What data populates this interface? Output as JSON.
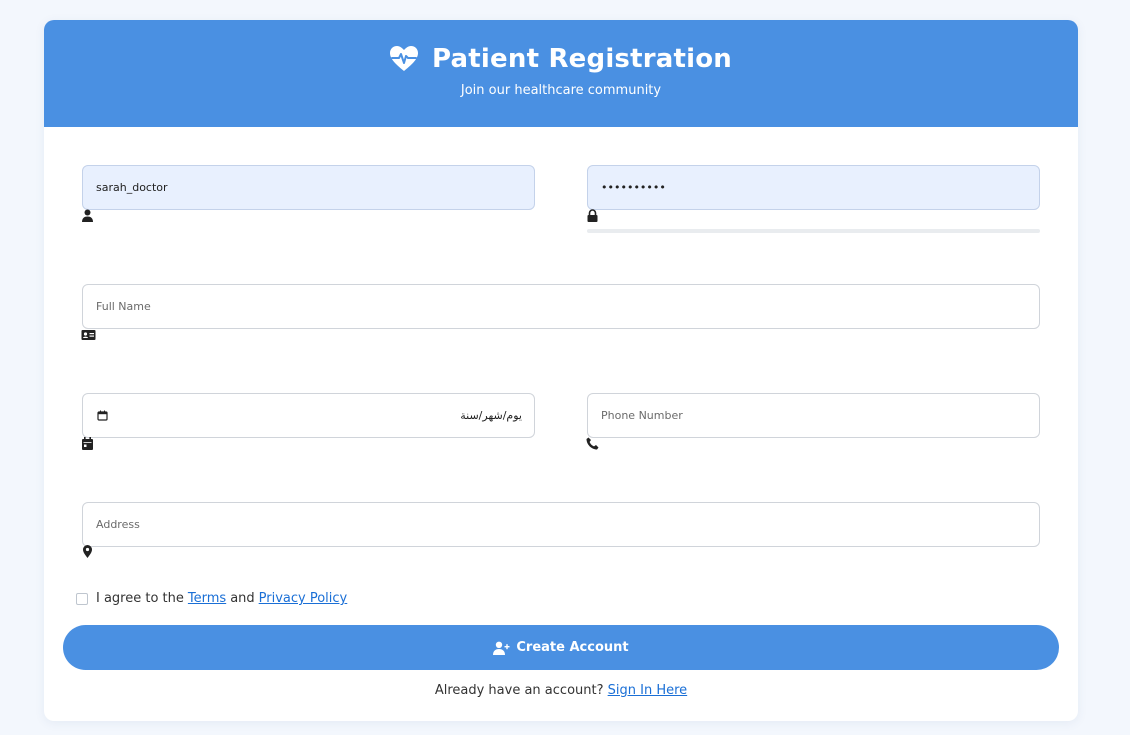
{
  "header": {
    "title": "Patient Registration",
    "subtitle": "Join our healthcare community",
    "icon": "heart-pulse-icon",
    "accent_color": "#4a90e2"
  },
  "form": {
    "username": {
      "value": "sarah_doctor",
      "icon": "user-icon"
    },
    "password": {
      "value": "••••••••••",
      "icon": "lock-icon",
      "strength": 0
    },
    "full_name": {
      "value": "",
      "placeholder": "Full Name",
      "icon": "id-card-icon"
    },
    "date_of_birth": {
      "value": "يوم/شهر/سنة",
      "icon": "calendar-icon"
    },
    "phone": {
      "value": "",
      "placeholder": "Phone Number",
      "icon": "phone-icon"
    },
    "address": {
      "value": "",
      "placeholder": "Address",
      "icon": "map-marker-icon"
    }
  },
  "agreement": {
    "prefix": "I agree to the",
    "terms_link": "Terms",
    "conjunction": "and",
    "privacy_link": "Privacy Policy",
    "checked": false
  },
  "submit": {
    "label": "Create Account",
    "icon": "user-plus-icon"
  },
  "footer": {
    "prompt": "Already have an account?",
    "signin_link": "Sign In Here"
  }
}
